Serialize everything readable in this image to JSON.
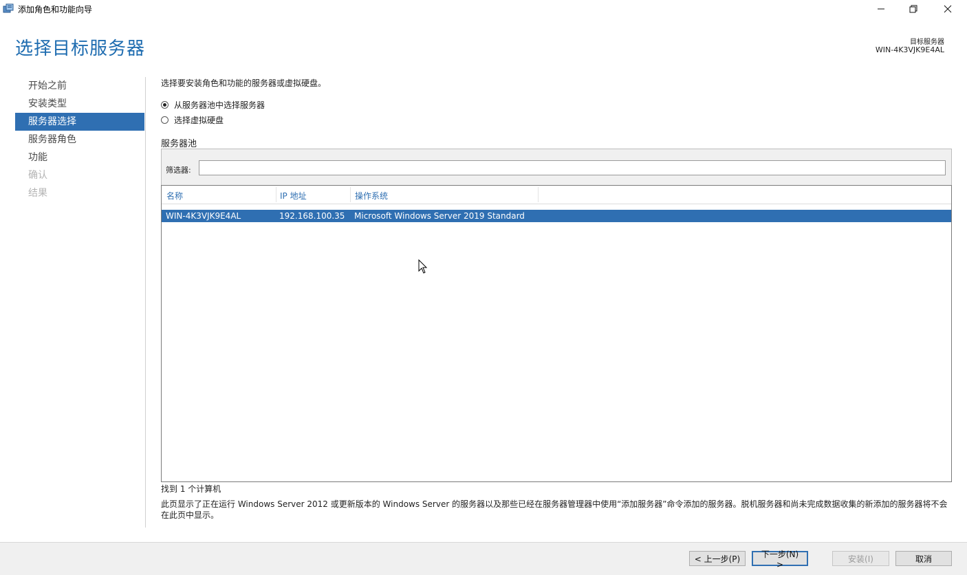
{
  "window": {
    "title": "添加角色和功能向导"
  },
  "header": {
    "title": "选择目标服务器",
    "target_label": "目标服务器",
    "target_value": "WIN-4K3VJK9E4AL"
  },
  "nav": {
    "items": [
      {
        "label": "开始之前",
        "state": "normal"
      },
      {
        "label": "安装类型",
        "state": "normal"
      },
      {
        "label": "服务器选择",
        "state": "active"
      },
      {
        "label": "服务器角色",
        "state": "normal"
      },
      {
        "label": "功能",
        "state": "normal"
      },
      {
        "label": "确认",
        "state": "disabled"
      },
      {
        "label": "结果",
        "state": "disabled"
      }
    ]
  },
  "content": {
    "instruction": "选择要安装角色和功能的服务器或虚拟硬盘。",
    "radio_pool": "从服务器池中选择服务器",
    "radio_vhd": "选择虚拟硬盘",
    "pool_label": "服务器池",
    "filter_label": "筛选器:",
    "filter_value": "",
    "columns": [
      "名称",
      "IP 地址",
      "操作系统"
    ],
    "rows": [
      {
        "name": "WIN-4K3VJK9E4AL",
        "ip": "192.168.100.35",
        "os": "Microsoft Windows Server 2019 Standard"
      }
    ],
    "found_text": "找到 1 个计算机",
    "description": "此页显示了正在运行 Windows Server 2012 或更新版本的 Windows Server 的服务器以及那些已经在服务器管理器中使用“添加服务器”命令添加的服务器。脱机服务器和尚未完成数据收集的新添加的服务器将不会在此页中显示。"
  },
  "footer": {
    "prev_label": "< 上一步(P)",
    "next_label": "下一步(N) >",
    "install_label": "安装(I)",
    "cancel_label": "取消"
  },
  "colors": {
    "accent": "#2f6fb2",
    "title": "#1e6cb0"
  }
}
